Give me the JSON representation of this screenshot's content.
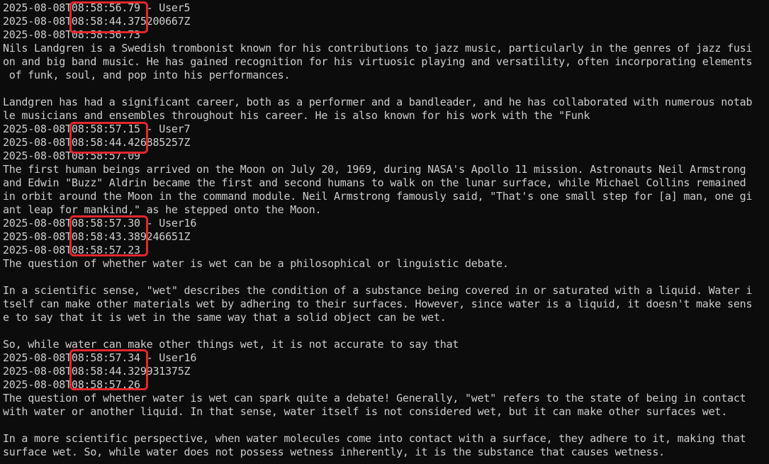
{
  "colors": {
    "background": "#0c0c0c",
    "text": "#cccccc",
    "highlight": "#e3262c"
  },
  "lines": [
    "2025-08-08T08:58:56.79 - User5",
    "2025-08-08T08:58:44.375200667Z",
    "2025-08-08T08:58:56.73",
    "Nils Landgren is a Swedish trombonist known for his contributions to jazz music, particularly in the genres of jazz fusi",
    "on and big band music. He has gained recognition for his virtuosic playing and versatility, often incorporating elements",
    " of funk, soul, and pop into his performances.",
    "",
    "Landgren has had a significant career, both as a performer and a bandleader, and he has collaborated with numerous notab",
    "le musicians and ensembles throughout his career. He is also known for his work with the \"Funk",
    "2025-08-08T08:58:57.15 - User7",
    "2025-08-08T08:58:44.426885257Z",
    "2025-08-08T08:58:57.09",
    "The first human beings arrived on the Moon on July 20, 1969, during NASA's Apollo 11 mission. Astronauts Neil Armstrong",
    "and Edwin \"Buzz\" Aldrin became the first and second humans to walk on the lunar surface, while Michael Collins remained",
    "in orbit around the Moon in the command module. Neil Armstrong famously said, \"That's one small step for [a] man, one gi",
    "ant leap for mankind,\" as he stepped onto the Moon.",
    "2025-08-08T08:58:57.30 - User16",
    "2025-08-08T08:58:43.389246651Z",
    "2025-08-08T08:58:57.23",
    "The question of whether water is wet can be a philosophical or linguistic debate.",
    "",
    "In a scientific sense, \"wet\" describes the condition of a substance being covered in or saturated with a liquid. Water i",
    "tself can make other materials wet by adhering to their surfaces. However, since water is a liquid, it doesn't make sens",
    "e to say that it is wet in the same way that a solid object can be wet.",
    "",
    "So, while water can make other things wet, it is not accurate to say that",
    "2025-08-08T08:58:57.34 - User16",
    "2025-08-08T08:58:44.329931375Z",
    "2025-08-08T08:58:57.26",
    "The question of whether water is wet can spark quite a debate! Generally, \"wet\" refers to the state of being in contact",
    "with water or another liquid. In that sense, water itself is not considered wet, but it can make other surfaces wet.",
    "",
    "In a more scientific perspective, when water molecules come into contact with a surface, they adhere to it, making that",
    "surface wet. So, while water does not possess wetness inherently, it is the substance that causes wetness."
  ]
}
